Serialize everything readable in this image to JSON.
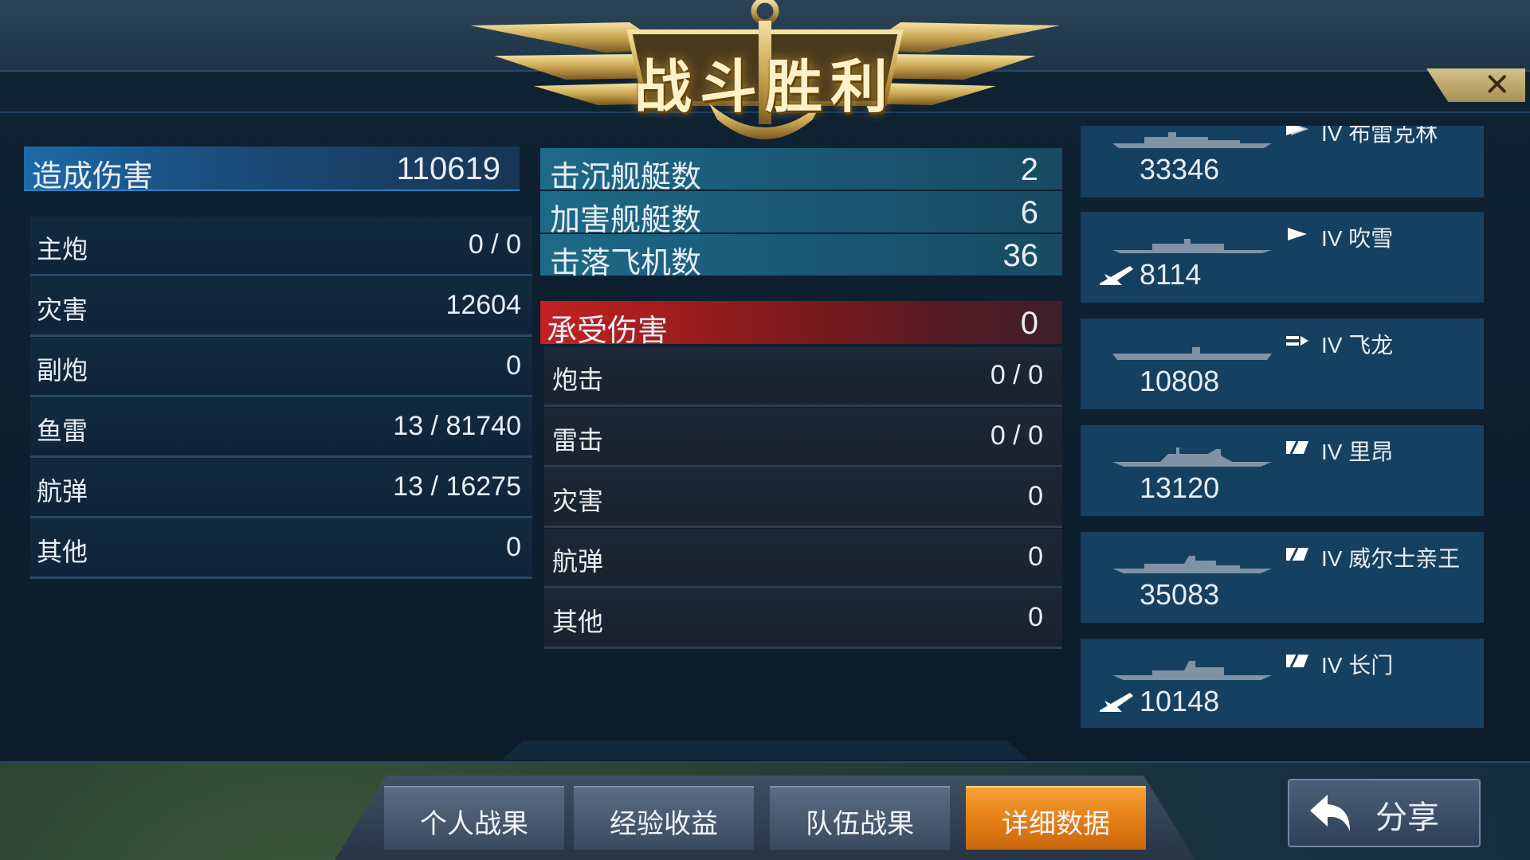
{
  "banner": {
    "title": "战斗胜利"
  },
  "close": {
    "label": "✕"
  },
  "left": {
    "head": {
      "label": "造成伤害",
      "value": "110619"
    },
    "rows": [
      {
        "label": "主炮",
        "value": "0 / 0"
      },
      {
        "label": "灾害",
        "value": "12604"
      },
      {
        "label": "副炮",
        "value": "0"
      },
      {
        "label": "鱼雷",
        "value": "13 / 81740"
      },
      {
        "label": "航弹",
        "value": "13 / 16275"
      },
      {
        "label": "其他",
        "value": "0"
      }
    ]
  },
  "middle": {
    "kills": [
      {
        "label": "击沉舰艇数",
        "value": "2"
      },
      {
        "label": "加害舰艇数",
        "value": "6"
      },
      {
        "label": "击落飞机数",
        "value": "36"
      }
    ],
    "received_head": {
      "label": "承受伤害",
      "value": "0"
    },
    "received": [
      {
        "label": "炮击",
        "value": "0 / 0"
      },
      {
        "label": "雷击",
        "value": "0 / 0"
      },
      {
        "label": "灾害",
        "value": "0"
      },
      {
        "label": "航弹",
        "value": "0"
      },
      {
        "label": "其他",
        "value": "0"
      }
    ]
  },
  "ships": [
    {
      "tier": "IV  布雷克林",
      "score": "33346",
      "icon": "cruiser-flag-icon",
      "plane": false
    },
    {
      "tier": "IV  吹雪",
      "score": "8114",
      "icon": "destroyer-flag-icon",
      "plane": true
    },
    {
      "tier": "IV  飞龙",
      "score": "10808",
      "icon": "carrier-flag-icon",
      "plane": false
    },
    {
      "tier": "IV  里昂",
      "score": "13120",
      "icon": "battleship-flag-icon",
      "plane": false
    },
    {
      "tier": "IV  威尔士亲王",
      "score": "35083",
      "icon": "battleship-flag-icon",
      "plane": false
    },
    {
      "tier": "IV  长门",
      "score": "10148",
      "icon": "battleship-flag-icon",
      "plane": true
    }
  ],
  "tabs": [
    {
      "label": "个人战果",
      "active": false
    },
    {
      "label": "经验收益",
      "active": false
    },
    {
      "label": "队伍战果",
      "active": false
    },
    {
      "label": "详细数据",
      "active": true
    }
  ],
  "share": {
    "label": "分享"
  },
  "colors": {
    "accent": "#e88a1c",
    "damage_blue": "#1d6aa8",
    "damage_red": "#c42222",
    "card": "#16405f"
  }
}
